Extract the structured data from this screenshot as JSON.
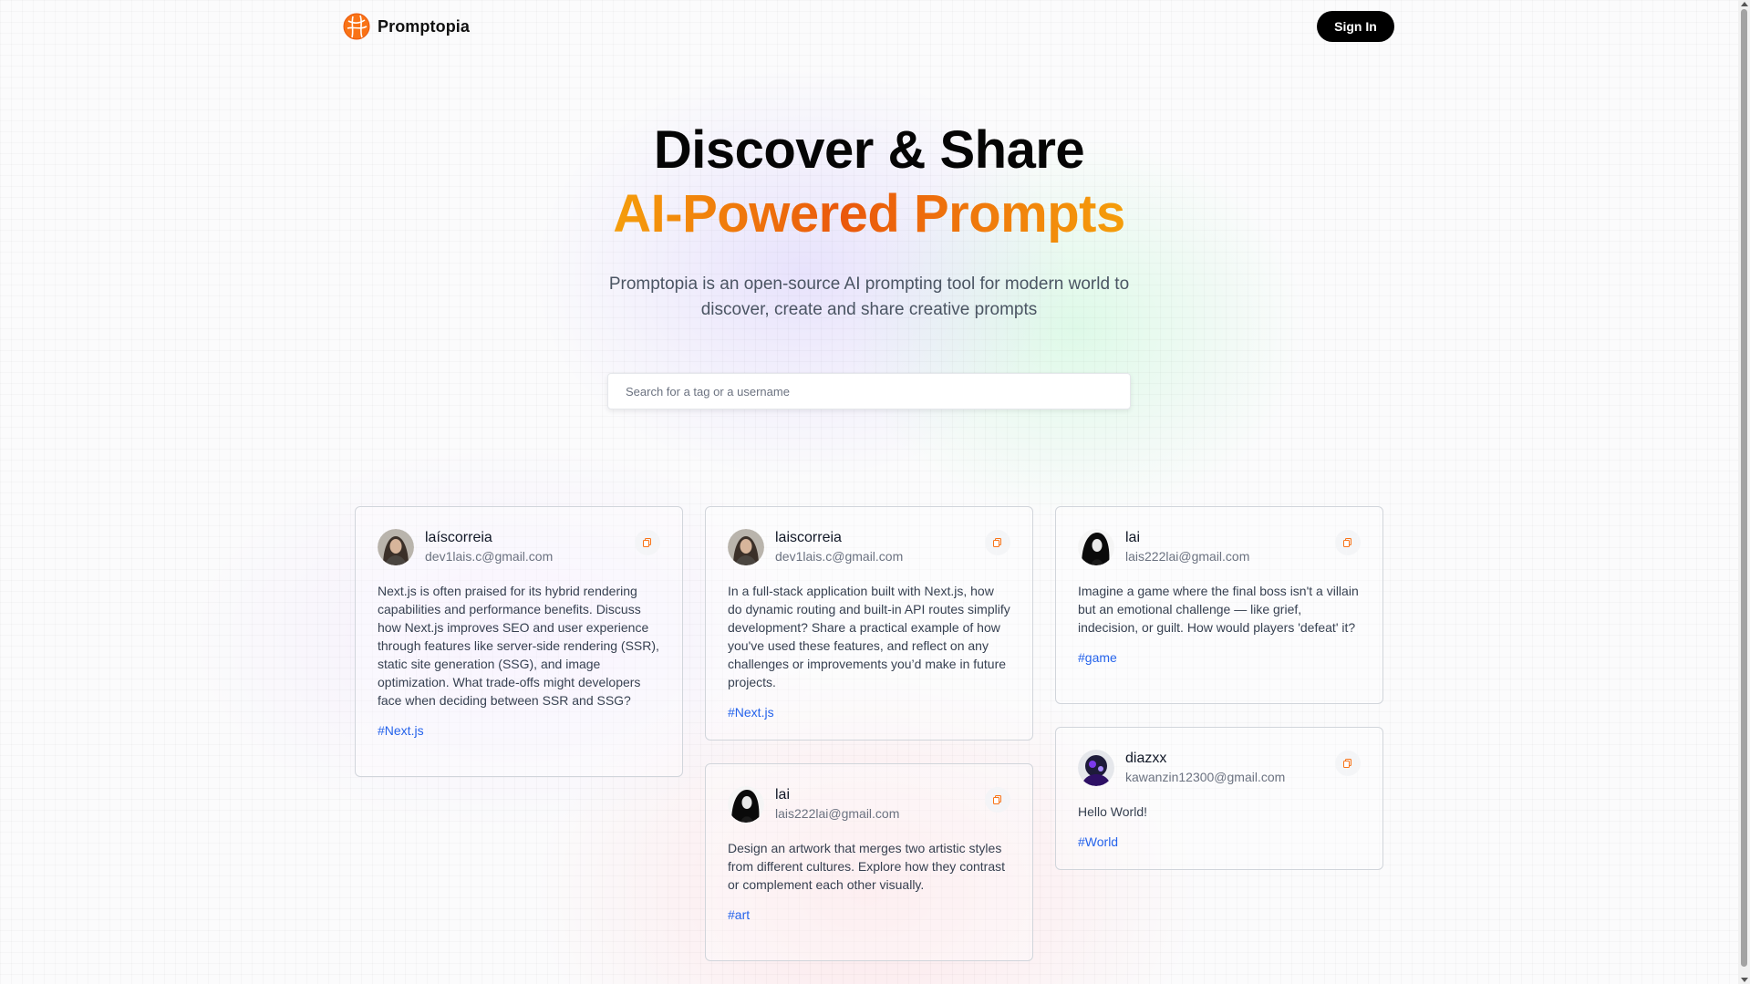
{
  "nav": {
    "brand": "Promptopia",
    "sign_in": "Sign In"
  },
  "hero": {
    "headline_line1": "Discover & Share",
    "headline_line2": "AI-Powered Prompts",
    "description": "Promptopia is an open-source AI prompting tool for modern world to discover, create and share creative prompts"
  },
  "search": {
    "placeholder": "Search for a tag or a username",
    "value": ""
  },
  "colors": {
    "accent_orange": "#ea580c",
    "tag_blue": "#2563eb"
  },
  "icons": {
    "copy": "copy-icon",
    "logo": "promptopia-logo-icon"
  },
  "posts": [
    {
      "username": "laíscorreia",
      "email": "dev1lais.c@gmail.com",
      "prompt": "Next.js is often praised for its hybrid rendering capabilities and performance benefits. Discuss how Next.js improves SEO and user experience through features like server-side rendering (SSR), static site generation (SSG), and image optimization. What trade-offs might developers face when deciding between SSR and SSG?",
      "tag": "#Next.js"
    },
    {
      "username": "laiscorreia",
      "email": "dev1lais.c@gmail.com",
      "prompt": "In a full-stack application built with Next.js, how do dynamic routing and built-in API routes simplify development? Share a practical example of how you've used these features, and reflect on any challenges or improvements you’d make in future projects.",
      "tag": "#Next.js"
    },
    {
      "username": "lai",
      "email": "lais222lai@gmail.com",
      "prompt": "Imagine a game where the final boss isn't a villain but an emotional challenge — like grief, indecision, or guilt. How would players 'defeat' it?",
      "tag": "#game"
    },
    {
      "username": "lai",
      "email": "lais222lai@gmail.com",
      "prompt": "Design an artwork that merges two artistic styles from different cultures. Explore how they contrast or complement each other visually.",
      "tag": "#art"
    },
    {
      "username": "diazxx",
      "email": "kawanzin12300@gmail.com",
      "prompt": "Hello World!",
      "tag": "#World"
    }
  ]
}
